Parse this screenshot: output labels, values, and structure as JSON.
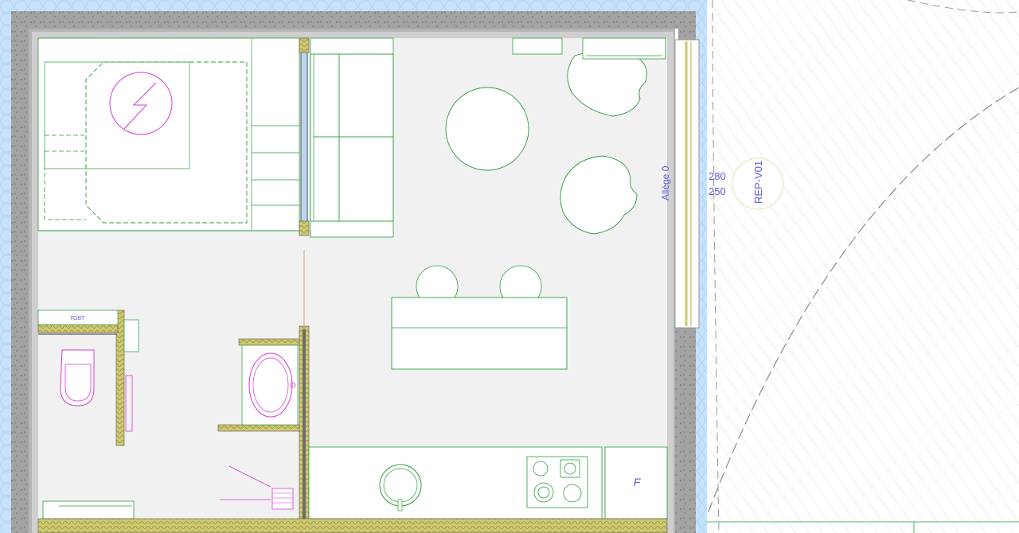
{
  "labels": {
    "electrical_panel": "TGBT",
    "sill_note": "Allège 0",
    "height_top": "280",
    "height_bottom": "250",
    "window_ref": "REP-V01",
    "fridge": "F"
  },
  "colors": {
    "furniture_line": "#2a9d3a",
    "sanitary_line": "#d63bd6",
    "wall_fill": "#9a9a9a",
    "insulation_fill": "#cfc870",
    "exterior_fill": "#c6e3fb",
    "annotation_text": "#5b5bd6",
    "floor_fill": "#f1f1f1"
  },
  "icons": {
    "electric_meter": "lightning-bolt-symbol",
    "basin_tap": "tap-symbol",
    "shower_drain": "drain-grate-symbol"
  }
}
